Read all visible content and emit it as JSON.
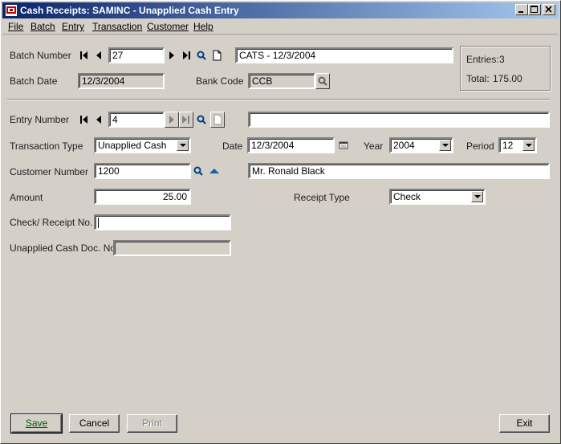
{
  "window": {
    "title": "Cash Receipts: SAMINC - Unapplied Cash Entry"
  },
  "menu": [
    {
      "label": "File"
    },
    {
      "label": "Batch"
    },
    {
      "label": "Entry"
    },
    {
      "label": "Transaction"
    },
    {
      "label": "Customer"
    },
    {
      "label": "Help"
    }
  ],
  "batch": {
    "number_label": "Batch Number",
    "number": "27",
    "description": "CATS - 12/3/2004",
    "date_label": "Batch Date",
    "date": "12/3/2004",
    "bank_code_label": "Bank Code",
    "bank_code": "CCB",
    "entries_label": "Entries:",
    "entries": "3",
    "total_label": "Total:",
    "total": "175.00"
  },
  "entry": {
    "number_label": "Entry Number",
    "number": "4",
    "description": "",
    "transaction_type_label": "Transaction Type",
    "transaction_type": "Unapplied Cash",
    "date_label": "Date",
    "date": "12/3/2004",
    "year_label": "Year",
    "year": "2004",
    "period_label": "Period",
    "period": "12",
    "customer_number_label": "Customer Number",
    "customer_number": "1200",
    "customer_name": "Mr. Ronald Black",
    "amount_label": "Amount",
    "amount": "25.00",
    "receipt_type_label": "Receipt Type",
    "receipt_type": "Check",
    "check_no_label": "Check/ Receipt No.",
    "check_no": "",
    "doc_no_label": "Unapplied Cash Doc. No.",
    "doc_no": ""
  },
  "buttons": {
    "save": "Save",
    "cancel": "Cancel",
    "print": "Print",
    "exit": "Exit"
  },
  "colors": {
    "title_start": "#0a246a",
    "title_end": "#a6caf0",
    "face": "#d4d0c8"
  }
}
